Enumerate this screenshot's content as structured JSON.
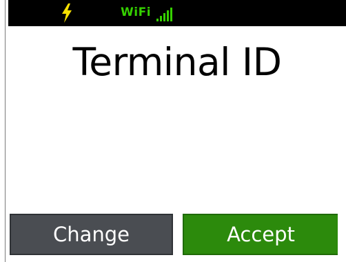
{
  "status_bar": {
    "battery_icon": "lightning-bolt-icon",
    "wifi_label": "WiFi",
    "signal_icon": "signal-bars-icon",
    "accent_color": "#35d000",
    "bolt_color": "#f7e000"
  },
  "screen": {
    "title": "Terminal ID"
  },
  "buttons": {
    "change_label": "Change",
    "accept_label": "Accept",
    "change_color": "#4a4d52",
    "accept_color": "#2c8a0c"
  }
}
